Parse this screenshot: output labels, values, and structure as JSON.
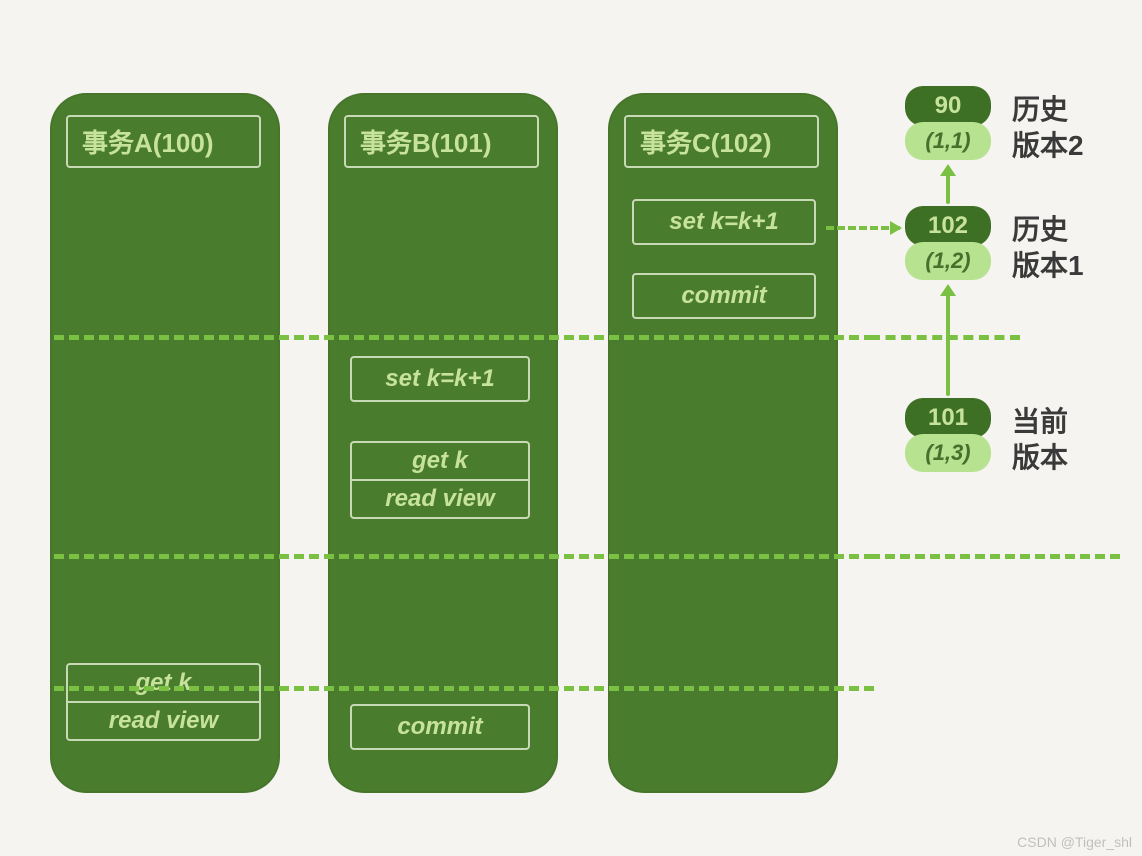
{
  "transactions": {
    "a": {
      "title": "事务A(100)",
      "get": "get k",
      "readview": "read view"
    },
    "b": {
      "title": "事务B(101)",
      "set": "set k=k+1",
      "get": "get k",
      "readview": "read view",
      "commit": "commit"
    },
    "c": {
      "title": "事务C(102)",
      "set": "set k=k+1",
      "commit": "commit"
    }
  },
  "versions": {
    "v2": {
      "id": "90",
      "data": "(1,1)",
      "label1": "历史",
      "label2": "版本2"
    },
    "v1": {
      "id": "102",
      "data": "(1,2)",
      "label1": "历史",
      "label2": "版本1"
    },
    "cur": {
      "id": "101",
      "data": "(1,3)",
      "label1": "当前",
      "label2": "版本"
    }
  },
  "watermark": "CSDN @Tiger_shl"
}
